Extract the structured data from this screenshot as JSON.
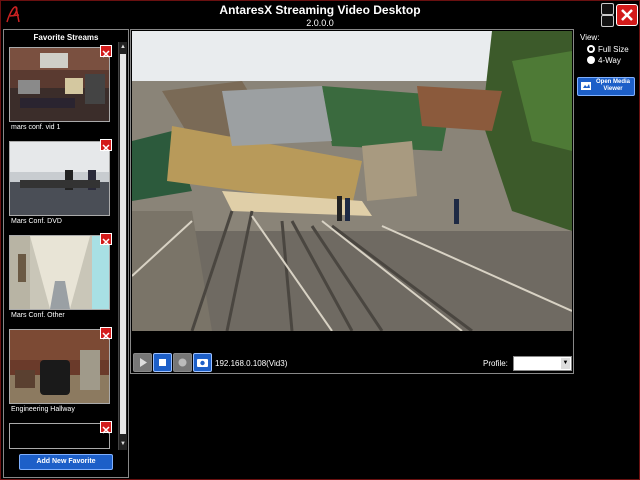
{
  "window": {
    "title": "AntaresX Streaming Video Desktop",
    "version": "2.0.0.0"
  },
  "favorites": {
    "title": "Favorite Streams",
    "items": [
      {
        "label": "mars conf. vid 1"
      },
      {
        "label": "Mars Conf. DVD"
      },
      {
        "label": "Mars Conf. Other"
      },
      {
        "label": "Engineering Hallway"
      },
      {
        "label": ""
      }
    ],
    "add_button": "Add New Favorite"
  },
  "player": {
    "stream_address": "192.168.0.108(Vid3)",
    "profile_label": "Profile:",
    "profile_value": ""
  },
  "view": {
    "label": "View:",
    "options": [
      {
        "label": "Full Size",
        "selected": true
      },
      {
        "label": "4-Way",
        "selected": false
      }
    ]
  },
  "media_button": {
    "line1": "Open Media",
    "line2": "Viewer"
  },
  "colors": {
    "accent_blue": "#1d5fc8",
    "close_red": "#d31b1b",
    "frame_red": "#6a1010"
  }
}
